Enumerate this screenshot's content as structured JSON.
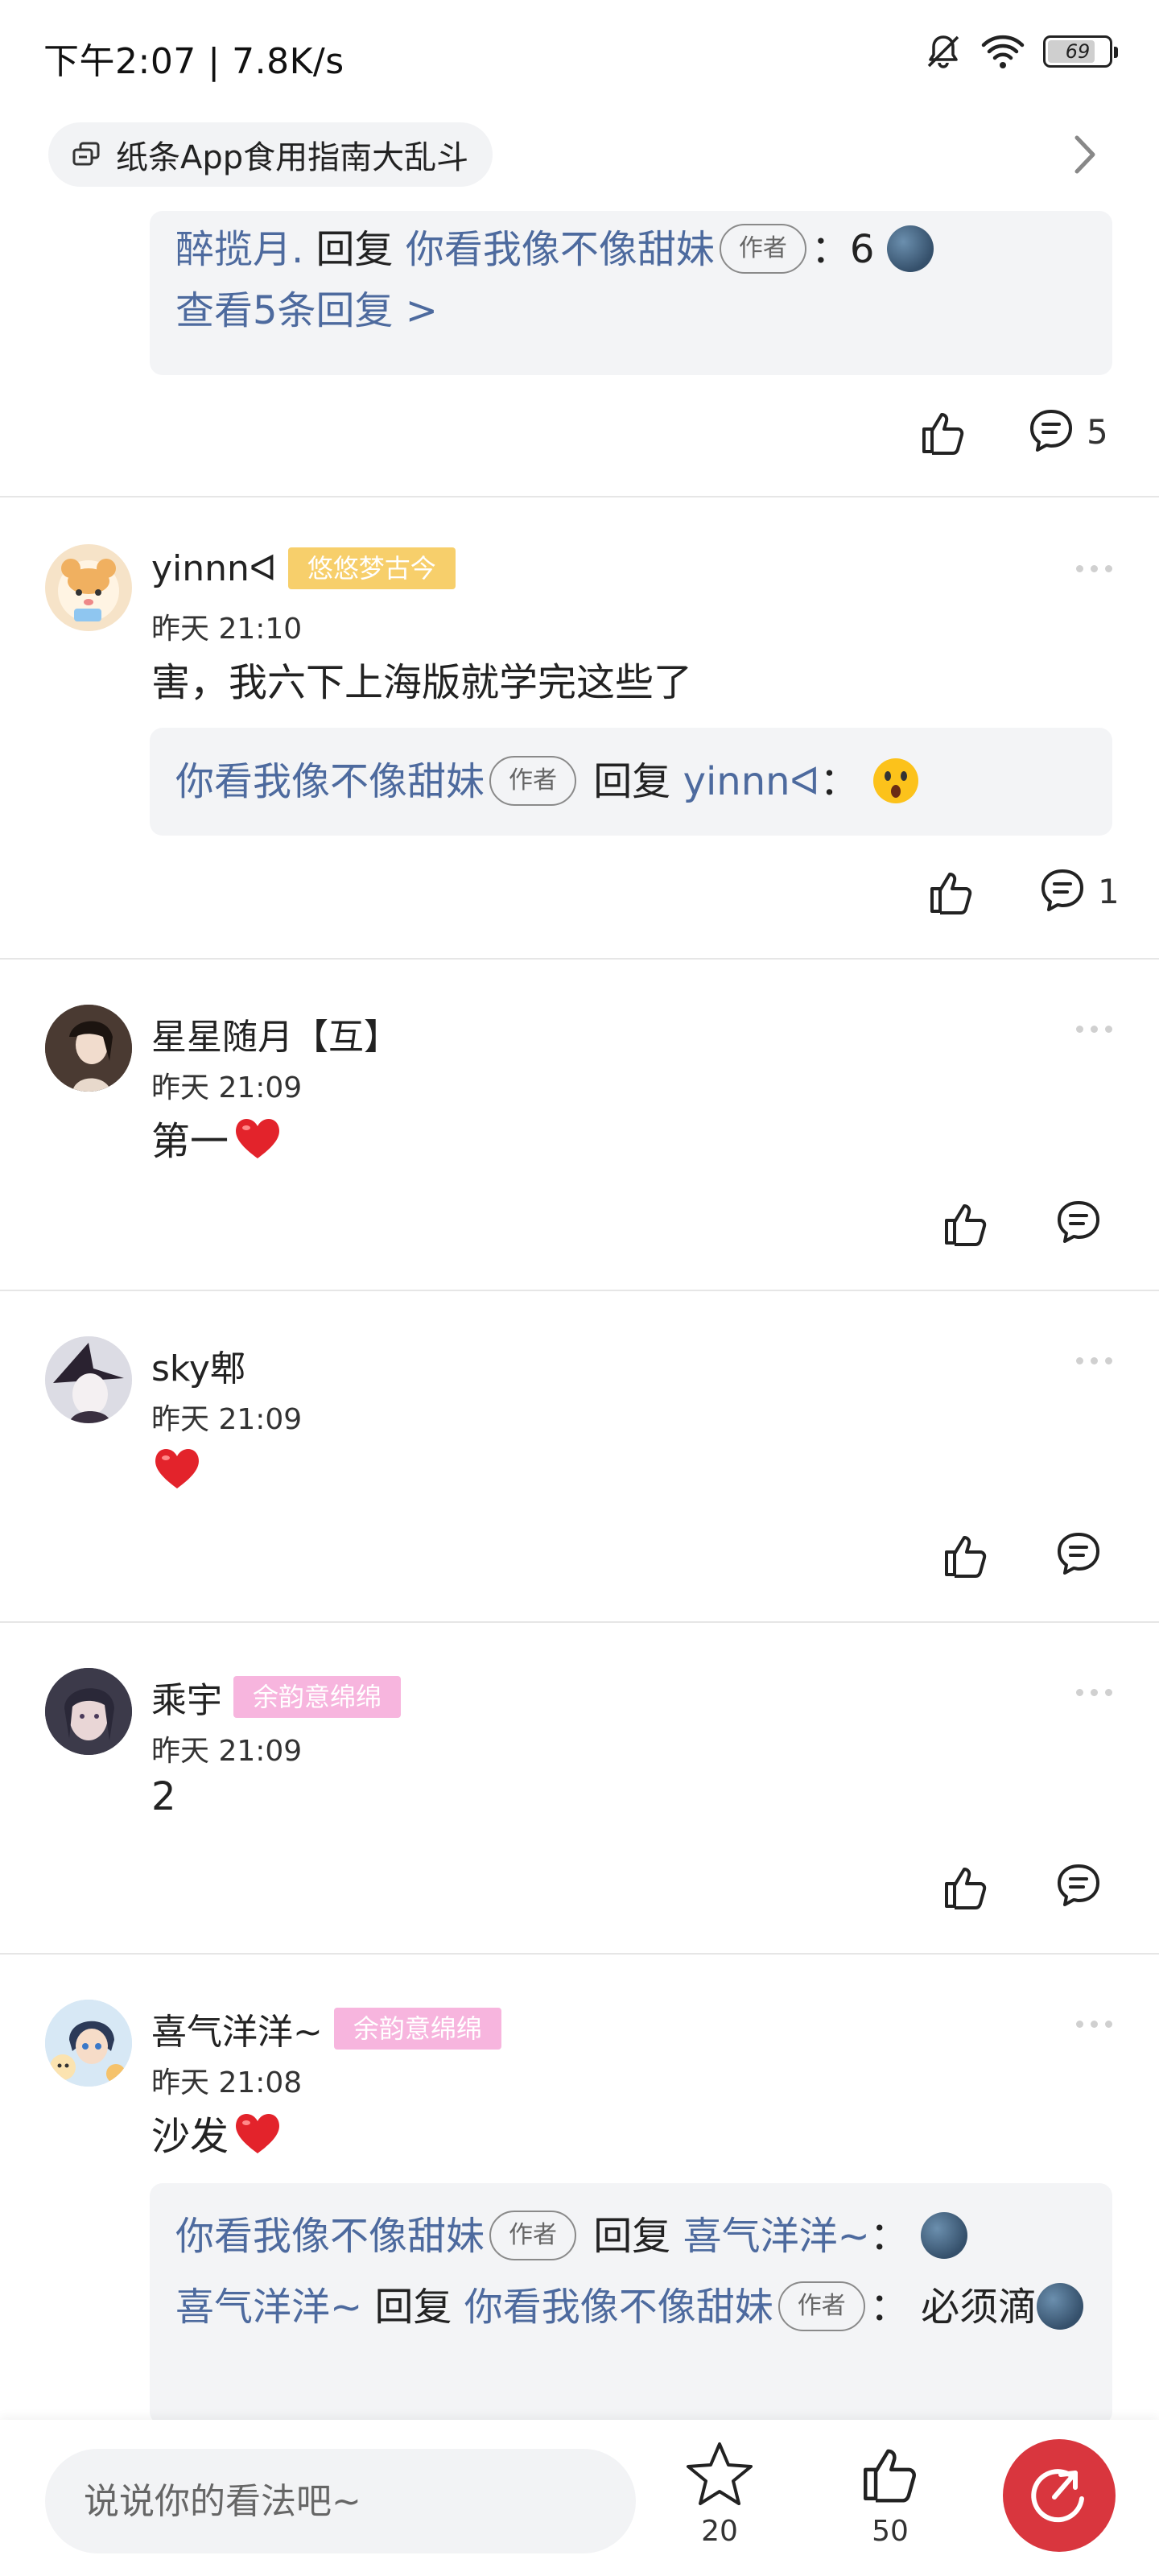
{
  "status_bar": {
    "time": "下午2:07 | 7.8K/s",
    "battery": "69"
  },
  "topic": {
    "label": "纸条App食用指南大乱斗"
  },
  "top_thread": {
    "reply_user": "醉揽月.",
    "reply_word": "回复",
    "reply_to": "你看我像不像甜妹",
    "author_tag": "作者",
    "colon": "：",
    "reply_text": "6",
    "view_more": "查看5条回复 >",
    "reply_count": "5"
  },
  "comments": [
    {
      "user": "yinnnᐊ",
      "badge": "悠悠梦古今",
      "time": "昨天 21:10",
      "text": "害，我六下上海版就学完这些了",
      "reply": {
        "from": "你看我像不像甜妹",
        "author_tag": "作者",
        "reply_word": "回复",
        "to": "yinnnᐊ",
        "colon": "："
      },
      "reply_count": "1"
    },
    {
      "user": "星星随月【互】",
      "time": "昨天 21:09",
      "text": "第一"
    },
    {
      "user": "sky郫",
      "time": "昨天 21:09",
      "text": ""
    },
    {
      "user": "乘宇",
      "badge": "余韵意绵绵",
      "time": "昨天 21:09",
      "text": "2"
    },
    {
      "user": "喜气洋洋~",
      "badge": "余韵意绵绵",
      "time": "昨天 21:08",
      "text": "沙发",
      "replies": [
        {
          "from": "你看我像不像甜妹",
          "author_tag": "作者",
          "reply_word": "回复",
          "to": "喜气洋洋~",
          "colon": "："
        },
        {
          "from": "喜气洋洋~",
          "reply_word": "回复",
          "to": "你看我像不像甜妹",
          "author_tag": "作者",
          "colon": "：",
          "text": "必须滴"
        }
      ]
    }
  ],
  "bottom_bar": {
    "placeholder": "说说你的看法吧~",
    "star_count": "20",
    "like_count": "50"
  },
  "colors": {
    "link": "#4d6a9e",
    "share": "#d9363e",
    "badge_gold": "#f7cf6b",
    "badge_pink": "#f7b5de"
  },
  "icons": [
    "bell-off-icon",
    "wifi-icon",
    "battery-icon",
    "topic-icon",
    "chevron-right-icon",
    "thumbs-up-icon",
    "comment-icon",
    "more-icon",
    "star-icon",
    "share-icon",
    "heart-emoji",
    "moon-emoji",
    "surprised-emoji"
  ]
}
